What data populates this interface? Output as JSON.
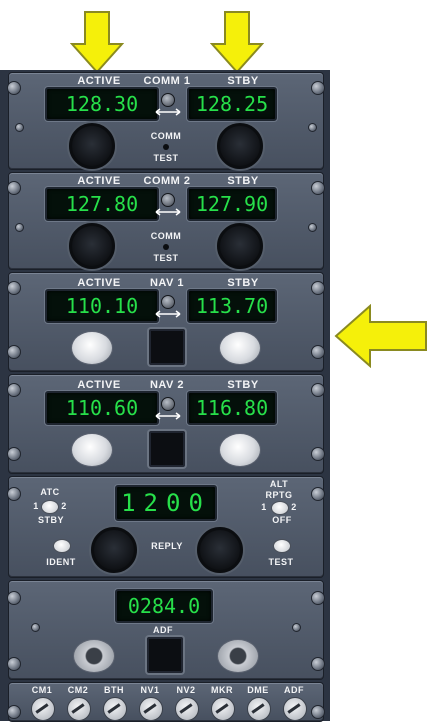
{
  "comm1": {
    "active_label": "ACTIVE",
    "title": "COMM 1",
    "standby_label": "STBY",
    "active_freq": "128.30",
    "standby_freq": "128.25",
    "comm_label": "COMM",
    "test_label": "TEST"
  },
  "comm2": {
    "active_label": "ACTIVE",
    "title": "COMM 2",
    "standby_label": "STBY",
    "active_freq": "127.80",
    "standby_freq": "127.90",
    "comm_label": "COMM",
    "test_label": "TEST"
  },
  "nav1": {
    "active_label": "ACTIVE",
    "title": "NAV 1",
    "standby_label": "STBY",
    "active_freq": "110.10",
    "standby_freq": "113.70"
  },
  "nav2": {
    "active_label": "ACTIVE",
    "title": "NAV 2",
    "standby_label": "STBY",
    "active_freq": "110.60",
    "standby_freq": "116.80"
  },
  "atc": {
    "atc_label": "ATC",
    "pos1": "1",
    "pos2": "2",
    "stby_label": "STBY",
    "code": "1200",
    "alt_label": "ALT",
    "rptg_label": "RPTG",
    "off_label": "OFF",
    "ident_label": "IDENT",
    "reply_label": "REPLY",
    "test_label": "TEST"
  },
  "adf": {
    "freq": "0284.0",
    "label": "ADF"
  },
  "audio": {
    "labels": [
      "CM1",
      "CM2",
      "BTH",
      "NV1",
      "NV2",
      "MKR",
      "DME",
      "ADF"
    ]
  },
  "colors": {
    "arrow": "#f5f00a",
    "display_text": "#27e04a",
    "panel": "#4f5868"
  },
  "icons": {
    "arrows": "yellow-block-arrow"
  }
}
